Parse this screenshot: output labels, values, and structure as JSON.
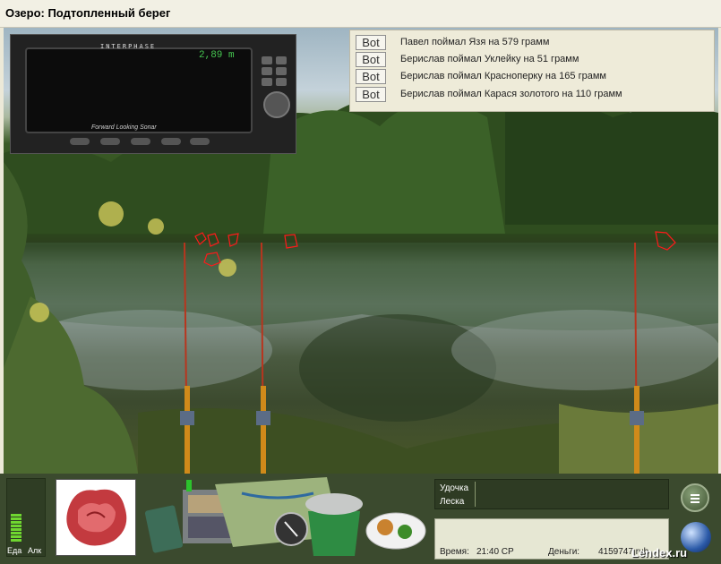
{
  "window": {
    "title": "Озеро: Подтопленный берег"
  },
  "sonar": {
    "brand": "INTERPHASE",
    "depth": "2,89 m",
    "caption": "Forward Looking Sonar"
  },
  "catch_log": [
    {
      "button": "Bot",
      "text": "Павел поймал Язя на 579 грамм"
    },
    {
      "button": "Bot",
      "text": "Берислав поймал Уклейку на 51 грамм"
    },
    {
      "button": "Bot",
      "text": "Берислав поймал Красноперку на 165 грамм"
    },
    {
      "button": "Bot",
      "text": "Берислав поймал Карася золотого на 110 грамм"
    }
  ],
  "rods": [
    {
      "label": "rod-1"
    },
    {
      "label": "rod-2"
    },
    {
      "label": "rod-3"
    }
  ],
  "bottom": {
    "food_label": "Еда",
    "alcohol_label": "Алк",
    "food_level": 0.35,
    "tackle_rod_label": "Удочка",
    "tackle_line_label": "Леска",
    "time_label": "Время:",
    "time_value": "21:40 СР",
    "money_label": "Деньги:",
    "money_value": "4159747 rub"
  },
  "watermark": "Lendex.ru",
  "colors": {
    "meter": "#6fd630",
    "panel": "#E6E7D3",
    "log_bg": "#EEEBD9"
  }
}
